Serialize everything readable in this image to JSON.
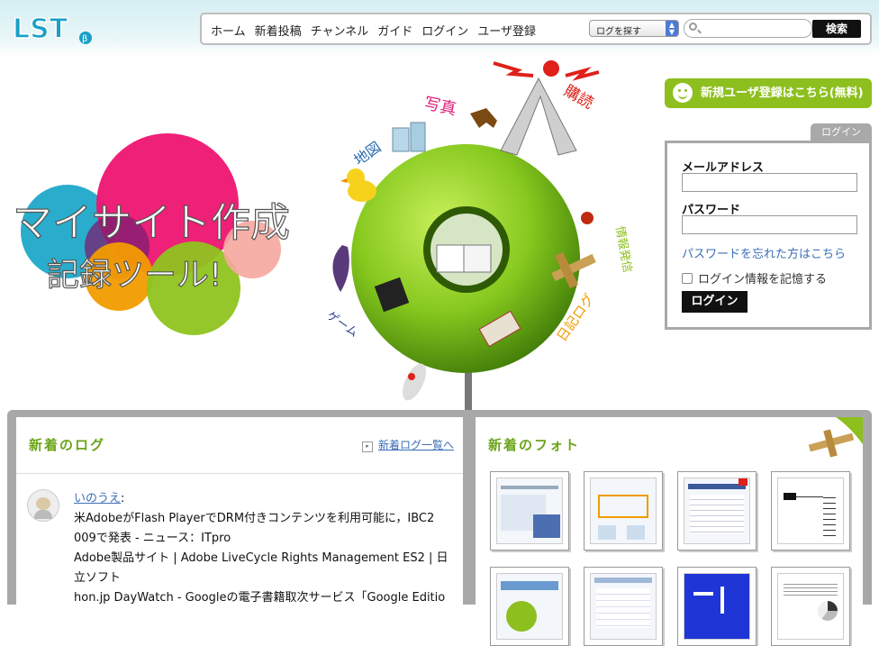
{
  "header": {
    "logo_text": "LST",
    "nav_items": [
      "ホーム",
      "新着投稿",
      "チャンネル",
      "ガイド",
      "ログイン",
      "ユーザ登録"
    ],
    "search_scope": "ログを探す",
    "search_value": "",
    "search_button": "検索"
  },
  "hero": {
    "title_line1": "マイサイト作成",
    "title_line2": "記録ツール!",
    "labels": [
      "写真",
      "購読",
      "地図",
      "情報発信",
      "ゲーム",
      "日記ログ"
    ]
  },
  "register_banner": "新規ユーザ登録はこちら(無料)",
  "login": {
    "tab": "ログイン",
    "email_label": "メールアドレス",
    "email_value": "",
    "password_label": "パスワード",
    "password_value": "",
    "forgot": "パスワードを忘れた方はこちら",
    "remember": "ログイン情報を記憶する",
    "button": "ログイン"
  },
  "new_logs": {
    "title": "新着のログ",
    "link": "新着ログ一覧へ",
    "entry": {
      "user": "いのうえ",
      "user_suffix": ":",
      "lines": [
        "米AdobeがFlash PlayerでDRM付きコンテンツを利用可能に，IBC2",
        "009で発表 - ニュース：ITpro",
        "Adobe製品サイト | Adobe LiveCycle Rights Management ES2 | 日",
        "立ソフト",
        "hon.jp DayWatch - Googleの電子書籍取次サービス「Google Editio"
      ]
    }
  },
  "new_photos": {
    "title": "新着のフォト"
  },
  "colors": {
    "accent_green": "#8dbf1f",
    "link_blue": "#3b6fb6",
    "panel_gray": "#a8a8a8"
  }
}
